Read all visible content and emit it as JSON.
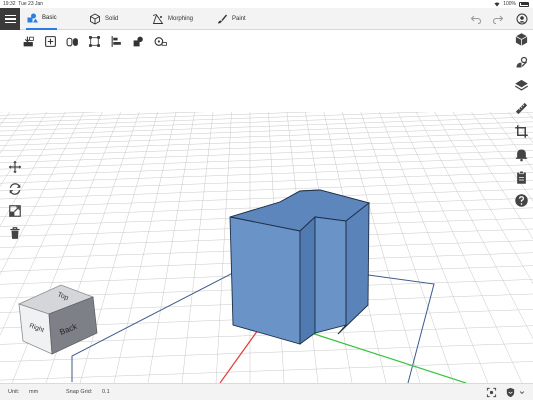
{
  "status_bar": {
    "time": "19:32",
    "date": "Tue 23 Jan",
    "battery": "100%"
  },
  "top_toolbar": {
    "mode_tabs": [
      {
        "label": "Basic",
        "icon": "basic-shapes-icon",
        "active": true
      },
      {
        "label": "Solid",
        "icon": "solid-cube-icon",
        "active": false
      },
      {
        "label": "Morphing",
        "icon": "morphing-icon",
        "active": false
      },
      {
        "label": "Paint",
        "icon": "paint-brush-icon",
        "active": false
      }
    ],
    "accent_color": "#2a7de1"
  },
  "bottom_bar": {
    "unit_label": "Unit:",
    "unit_value": "mm",
    "snap_label": "Snap Grid:",
    "snap_value": "0.1"
  },
  "view_cube": {
    "faces": [
      "Top",
      "Right",
      "Back"
    ]
  },
  "colors": {
    "model_fill": "#6a93c8",
    "model_top": "#5d86bd",
    "model_edge": "#1e2e48",
    "grid": "#c8c8c8",
    "x_axis": "#e03a3a",
    "y_axis": "#39c23f"
  }
}
